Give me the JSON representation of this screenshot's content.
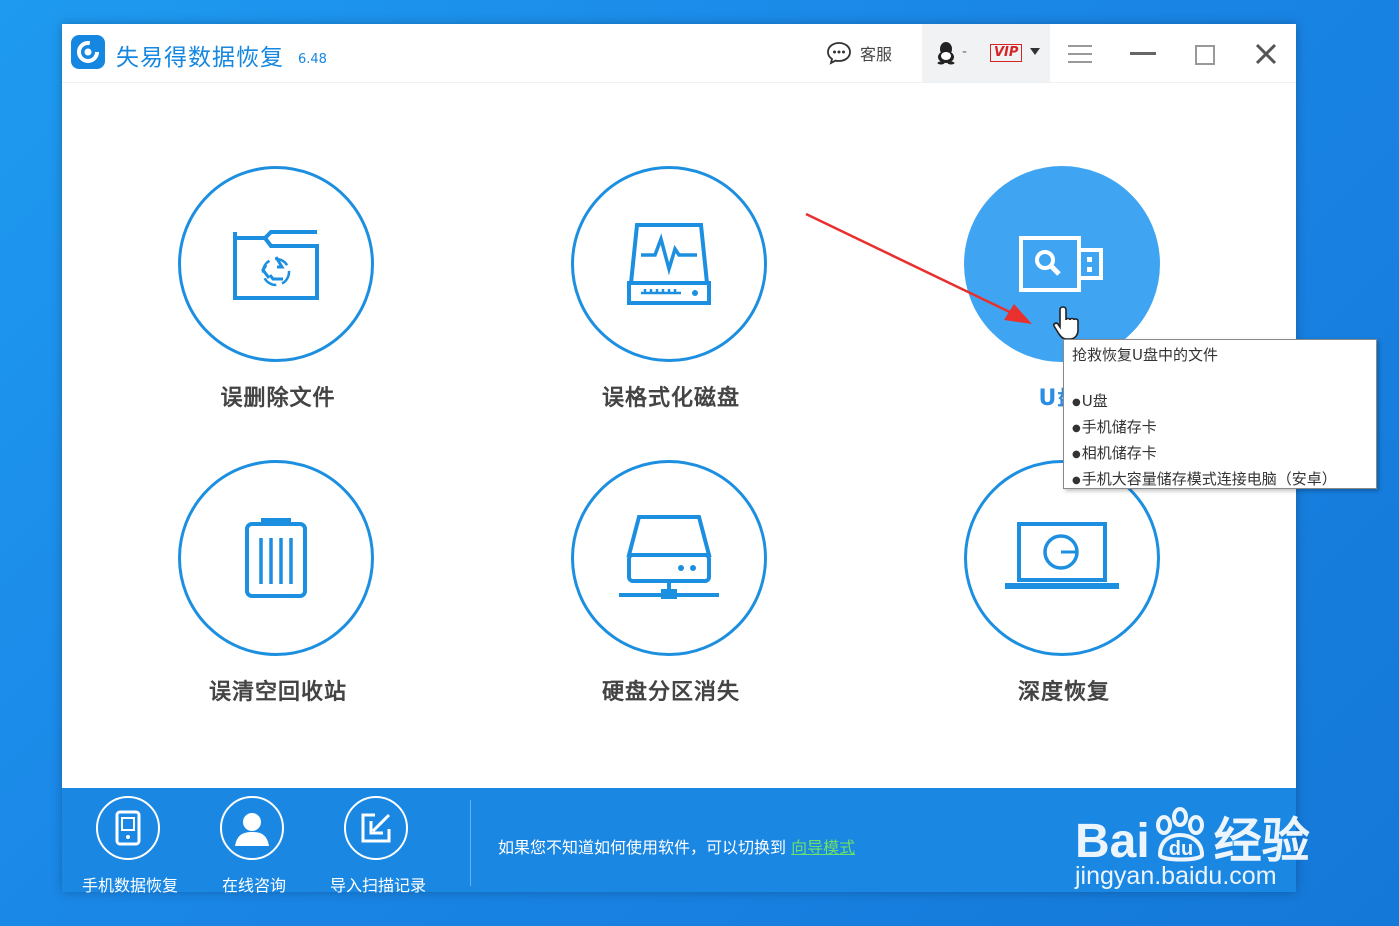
{
  "window": {
    "title": "失易得数据恢复",
    "version": "6.48",
    "support_label": "客服",
    "account_dash": "-",
    "vip_label": "VIP"
  },
  "tiles": [
    {
      "label": "误删除文件",
      "icon": "folder-recycle-icon"
    },
    {
      "label": "误格式化磁盘",
      "icon": "disk-pulse-icon"
    },
    {
      "label": "U盘/存储卡",
      "icon": "usb-search-icon",
      "visible_label": "U盘/"
    },
    {
      "label": "误清空回收站",
      "icon": "trash-icon"
    },
    {
      "label": "硬盘分区消失",
      "icon": "network-drive-icon"
    },
    {
      "label": "深度恢复",
      "icon": "laptop-scan-icon"
    }
  ],
  "tooltip": {
    "title": "抢救恢复U盘中的文件",
    "items": [
      "U盘",
      "手机储存卡",
      "相机储存卡",
      "手机大容量储存模式连接电脑（安卓）"
    ]
  },
  "bottom": {
    "items": [
      {
        "label": "手机数据恢复",
        "icon": "phone-icon"
      },
      {
        "label": "在线咨询",
        "icon": "user-icon"
      },
      {
        "label": "导入扫描记录",
        "icon": "import-icon"
      }
    ],
    "hint": "如果您不知道如何使用软件，可以切换到",
    "hint_link": "向导模式"
  },
  "watermark": {
    "brand": "Bai",
    "brand_suffix": "经验",
    "url": "jingyan.baidu.com"
  },
  "colors": {
    "accent": "#1d8fe0",
    "active_tile": "#3fa5f2",
    "bottom_bar": "#1a87e3",
    "annotation_arrow": "#e8312f"
  }
}
